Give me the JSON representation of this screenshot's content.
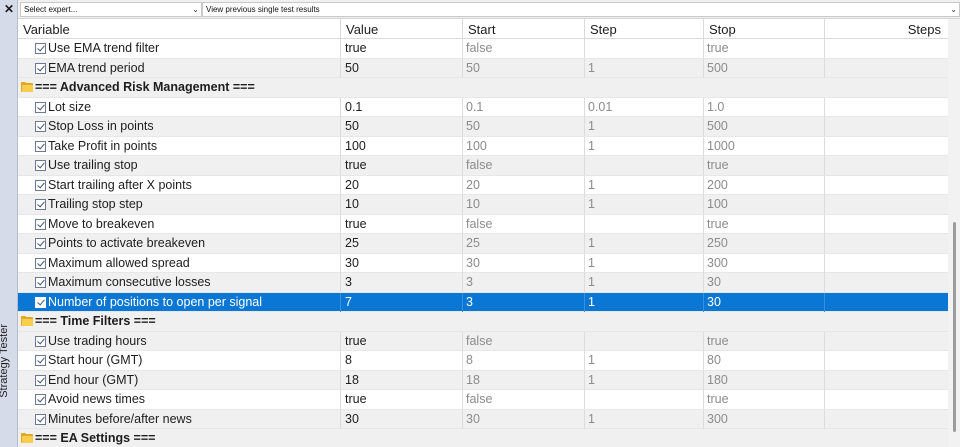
{
  "side": {
    "close_symbol": "✕",
    "label": "Strategy Tester"
  },
  "toolbar": {
    "expert_select": "Select expert...",
    "history_select": "View previous single test results"
  },
  "columns": {
    "variable": "Variable",
    "value": "Value",
    "start": "Start",
    "step": "Step",
    "stop": "Stop",
    "steps": "Steps"
  },
  "rows": [
    {
      "type": "param",
      "name": "Use EMA trend filter",
      "value": "true",
      "start": "false",
      "step": "",
      "stop": "true"
    },
    {
      "type": "param",
      "name": "EMA trend period",
      "value": "50",
      "start": "50",
      "step": "1",
      "stop": "500"
    },
    {
      "type": "group",
      "name": "=== Advanced Risk Management ==="
    },
    {
      "type": "param",
      "name": "Lot size",
      "value": "0.1",
      "start": "0.1",
      "step": "0.01",
      "stop": "1.0"
    },
    {
      "type": "param",
      "name": "Stop Loss in points",
      "value": "50",
      "start": "50",
      "step": "1",
      "stop": "500"
    },
    {
      "type": "param",
      "name": "Take Profit in points",
      "value": "100",
      "start": "100",
      "step": "1",
      "stop": "1000"
    },
    {
      "type": "param",
      "name": "Use trailing stop",
      "value": "true",
      "start": "false",
      "step": "",
      "stop": "true"
    },
    {
      "type": "param",
      "name": "Start trailing after X points",
      "value": "20",
      "start": "20",
      "step": "1",
      "stop": "200"
    },
    {
      "type": "param",
      "name": "Trailing stop step",
      "value": "10",
      "start": "10",
      "step": "1",
      "stop": "100"
    },
    {
      "type": "param",
      "name": "Move to breakeven",
      "value": "true",
      "start": "false",
      "step": "",
      "stop": "true"
    },
    {
      "type": "param",
      "name": "Points to activate breakeven",
      "value": "25",
      "start": "25",
      "step": "1",
      "stop": "250"
    },
    {
      "type": "param",
      "name": "Maximum allowed spread",
      "value": "30",
      "start": "30",
      "step": "1",
      "stop": "300"
    },
    {
      "type": "param",
      "name": "Maximum consecutive losses",
      "value": "3",
      "start": "3",
      "step": "1",
      "stop": "30"
    },
    {
      "type": "param",
      "name": "Number of positions to open per signal",
      "value": "7",
      "start": "3",
      "step": "1",
      "stop": "30",
      "selected": true
    },
    {
      "type": "group",
      "name": "=== Time Filters ==="
    },
    {
      "type": "param",
      "name": "Use trading hours",
      "value": "true",
      "start": "false",
      "step": "",
      "stop": "true"
    },
    {
      "type": "param",
      "name": "Start hour (GMT)",
      "value": "8",
      "start": "8",
      "step": "1",
      "stop": "80"
    },
    {
      "type": "param",
      "name": "End hour (GMT)",
      "value": "18",
      "start": "18",
      "step": "1",
      "stop": "180"
    },
    {
      "type": "param",
      "name": "Avoid news times",
      "value": "true",
      "start": "false",
      "step": "",
      "stop": "true"
    },
    {
      "type": "param",
      "name": "Minutes before/after news",
      "value": "30",
      "start": "30",
      "step": "1",
      "stop": "300"
    },
    {
      "type": "group",
      "name": "=== EA Settings ==="
    }
  ]
}
